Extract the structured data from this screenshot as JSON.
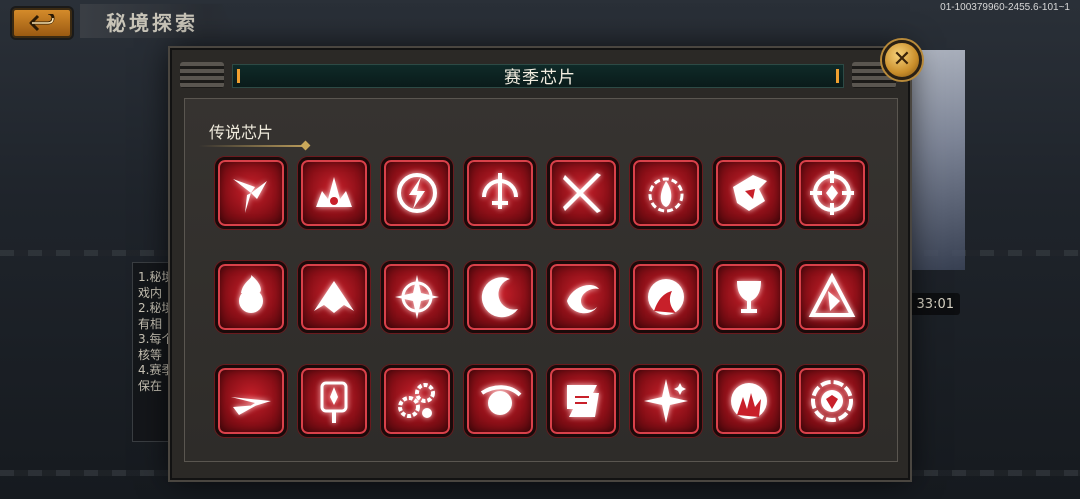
{
  "header": {
    "back_icon": "back-arrow-icon",
    "title": "秘境探索",
    "build_id": "01-100379960-2455.6-101~1"
  },
  "background": {
    "left_panel_text": "1.秘境\n戏内\n2.秘境\n有相\n3.每个\n核等\n4.赛季\n保在",
    "timer_text": "33:01"
  },
  "modal": {
    "title": "赛季芯片",
    "close_icon": "close-icon",
    "section_title": "传说芯片",
    "chips": [
      {
        "icon": "triple-blade-icon"
      },
      {
        "icon": "crown-spike-icon"
      },
      {
        "icon": "lightning-circle-icon"
      },
      {
        "icon": "sword-sun-icon"
      },
      {
        "icon": "crossed-blades-icon"
      },
      {
        "icon": "flame-ring-icon"
      },
      {
        "icon": "fist-strike-icon"
      },
      {
        "icon": "crosshair-target-icon"
      },
      {
        "icon": "burning-orb-icon"
      },
      {
        "icon": "rising-peak-icon"
      },
      {
        "icon": "star-compass-icon"
      },
      {
        "icon": "crescent-slash-icon"
      },
      {
        "icon": "splash-swirl-icon"
      },
      {
        "icon": "moon-silhouette-icon"
      },
      {
        "icon": "chalice-icon"
      },
      {
        "icon": "broken-triangle-icon"
      },
      {
        "icon": "dash-wing-icon"
      },
      {
        "icon": "torch-shield-icon"
      },
      {
        "icon": "gears-icon"
      },
      {
        "icon": "orbit-globe-icon"
      },
      {
        "icon": "scroll-banner-icon"
      },
      {
        "icon": "four-point-star-icon"
      },
      {
        "icon": "hand-wave-icon"
      },
      {
        "icon": "emblem-ring-icon"
      }
    ]
  }
}
